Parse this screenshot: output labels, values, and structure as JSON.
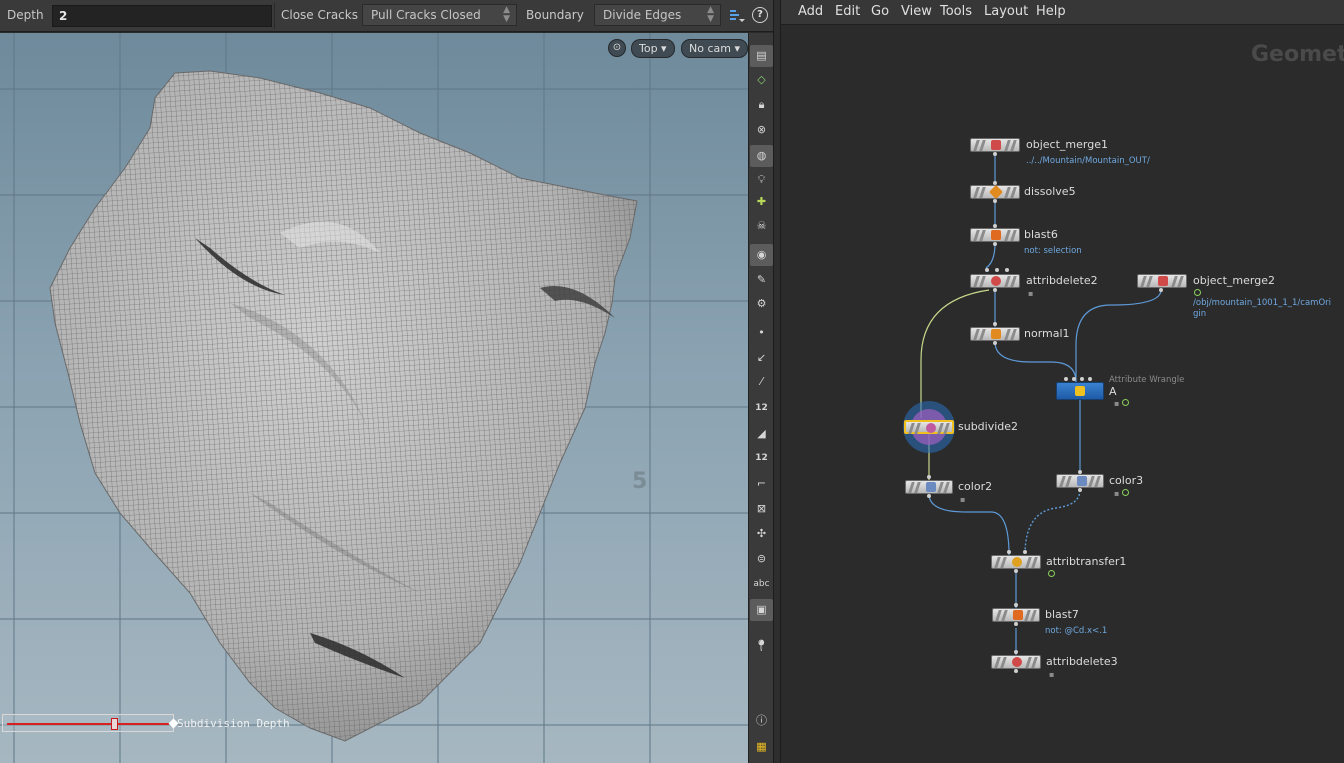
{
  "parms": {
    "depth_label": "Depth",
    "depth_value": "2",
    "close_cracks_label": "Close Cracks",
    "close_cracks_value": "Pull Cracks Closed",
    "boundary_label": "Boundary",
    "boundary_value": "Divide Edges",
    "help_icon": "help-icon",
    "options_icon": "list-options-icon"
  },
  "viewport": {
    "view_label": "Top",
    "camera_label": "No cam",
    "axis_number": "5",
    "slider_label": "Subdivision Depth",
    "slider_value_fraction": 0.65
  },
  "toolbar": {
    "tools": [
      "display-options-icon",
      "wireframe-icon",
      "lock-icon",
      "close-icon",
      "ghost-icon",
      "light-icon",
      "add-light-icon",
      "skull-icon",
      "sphere-icon",
      "camera-icon",
      "camera-settings-icon",
      "point-icon",
      "normal-icon",
      "pick-icon",
      "number-12-icon",
      "paint-icon",
      "number-12-bold-icon",
      "angle-icon",
      "snap-icon",
      "joint-icon",
      "list-icon",
      "abc-icon",
      "image-icon",
      "pin-icon",
      "info-icon",
      "grid-icon"
    ],
    "abc_text": "abc",
    "num_text": "12"
  },
  "network": {
    "menus": [
      "Add",
      "Edit",
      "Go",
      "View",
      "Tools",
      "Layout",
      "Help"
    ],
    "title": "Geometry",
    "nodes": [
      {
        "name": "object_merge1",
        "sub": "../../Mountain/Mountain_OUT/"
      },
      {
        "name": "dissolve5",
        "sub": ""
      },
      {
        "name": "blast6",
        "sub": "not: selection"
      },
      {
        "name": "attribdelete2",
        "sub": ""
      },
      {
        "name": "object_merge2",
        "sub": "/obj/mountain_1001_1_1/camOrigin"
      },
      {
        "name": "normal1",
        "sub": ""
      },
      {
        "name": "A",
        "sub": "Attribute Wrangle"
      },
      {
        "name": "subdivide2",
        "sub": ""
      },
      {
        "name": "color2",
        "sub": ""
      },
      {
        "name": "color3",
        "sub": ""
      },
      {
        "name": "attribtransfer1",
        "sub": ""
      },
      {
        "name": "blast7",
        "sub": "not: @Cd.x<.1"
      },
      {
        "name": "attribdelete3",
        "sub": ""
      }
    ]
  },
  "colors": {
    "accent_yellow": "#f0c020",
    "wrangle_blue": "#2a6fc0",
    "selection_purple": "#8a5ab8",
    "path_blue": "#6fa8e0",
    "slider_red": "#d8201e"
  }
}
